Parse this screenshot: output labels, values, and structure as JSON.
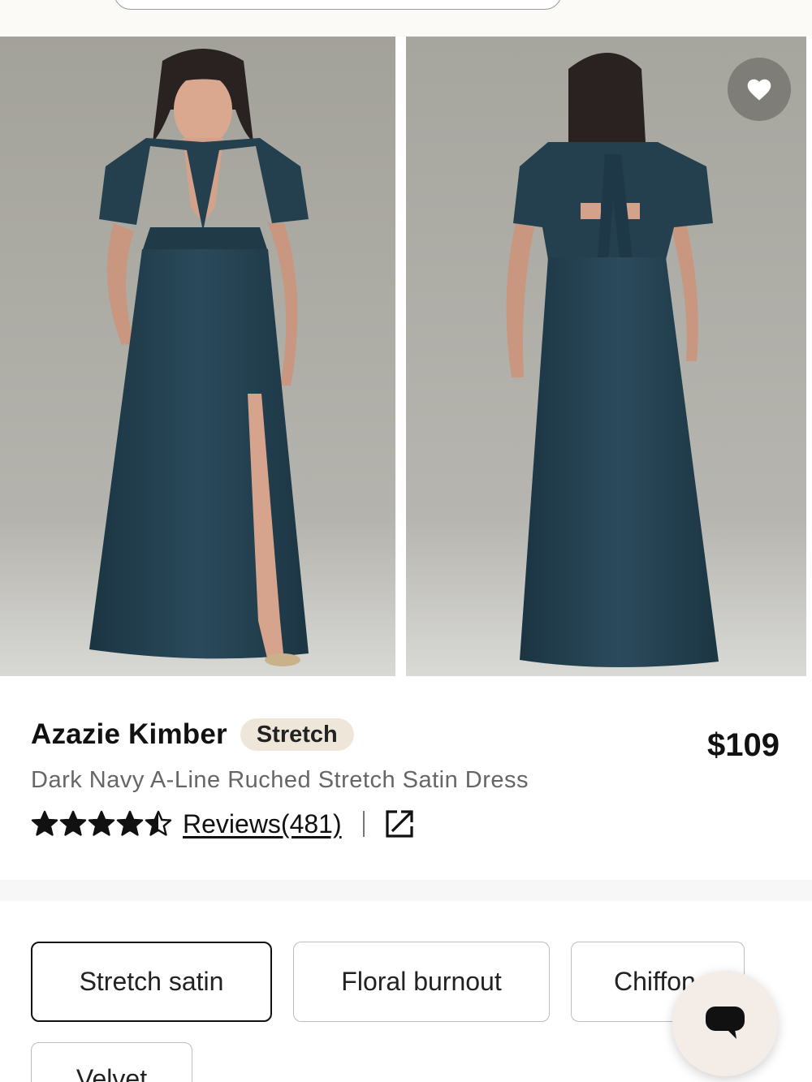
{
  "product": {
    "name": "Azazie Kimber",
    "badge": "Stretch",
    "price": "$109",
    "subtitle": "Dark Navy A-Line Ruched Stretch Satin Dress",
    "rating": 4.5,
    "rating_max": 5,
    "reviews_label": "Reviews(481)"
  },
  "gallery": {
    "images": [
      "front-view-photo",
      "back-view-photo"
    ],
    "dress_color": "#24404f",
    "backdrop_color": "#a9a8a1"
  },
  "fabrics": {
    "options": [
      {
        "label": "Stretch satin",
        "selected": true
      },
      {
        "label": "Floral burnout",
        "selected": false
      },
      {
        "label": "Chiffon",
        "selected": false
      },
      {
        "label": "Velvet",
        "selected": false
      }
    ]
  },
  "icons": {
    "wishlist": "heart-icon",
    "share": "external-link-icon",
    "chat": "chat-bubble-icon"
  }
}
